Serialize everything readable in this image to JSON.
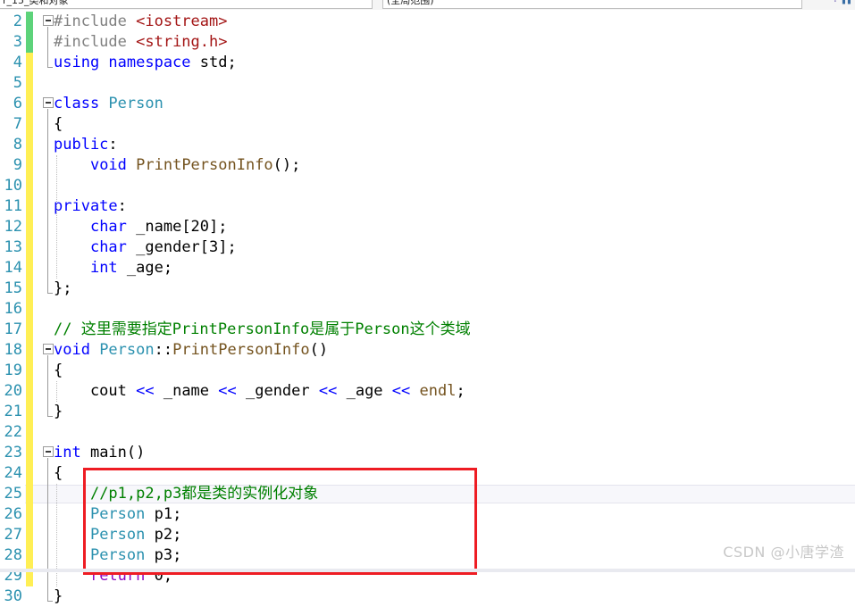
{
  "window": {
    "scope_left_label": "r_15_类和对象",
    "scope_right_label": "(全局范围)",
    "nav_back_icon": "navigate-back-icon",
    "nav_split_icon": "split-view-icon"
  },
  "editor": {
    "first_line_number": 2,
    "line_height_px": 23,
    "gutter": {
      "line_numbers": [
        2,
        3,
        4,
        5,
        6,
        7,
        8,
        9,
        10,
        11,
        12,
        13,
        14,
        15,
        16,
        17,
        18,
        19,
        20,
        21,
        22,
        23,
        24,
        25,
        26,
        27,
        28,
        29,
        30
      ],
      "change_bar": [
        {
          "status": "saved",
          "color": "#5dd37a",
          "from_line": 2,
          "to_line": 3
        },
        {
          "status": "unsaved",
          "color": "#ffef55",
          "from_line": 4,
          "to_line": 29
        }
      ]
    },
    "lines": [
      {
        "n": 2,
        "indent": 0,
        "fold": "open",
        "tokens": [
          {
            "t": "#include ",
            "c": "pre"
          },
          {
            "t": "<iostream>",
            "c": "str"
          }
        ]
      },
      {
        "n": 3,
        "indent": 0,
        "fold": "mid",
        "tokens": [
          {
            "t": "#include ",
            "c": "pre"
          },
          {
            "t": "<string.h>",
            "c": "str"
          }
        ]
      },
      {
        "n": 4,
        "indent": 0,
        "fold": "end",
        "tokens": [
          {
            "t": "using namespace ",
            "c": "kw"
          },
          {
            "t": "std;",
            "c": "plain"
          }
        ]
      },
      {
        "n": 5,
        "indent": 0,
        "fold": "none",
        "tokens": []
      },
      {
        "n": 6,
        "indent": 0,
        "fold": "open",
        "tokens": [
          {
            "t": "class ",
            "c": "kw"
          },
          {
            "t": "Person",
            "c": "type"
          }
        ]
      },
      {
        "n": 7,
        "indent": 0,
        "fold": "mid",
        "tokens": [
          {
            "t": "{",
            "c": "plain"
          }
        ]
      },
      {
        "n": 8,
        "indent": 0,
        "fold": "mid",
        "tokens": [
          {
            "t": "public",
            "c": "kw"
          },
          {
            "t": ":",
            "c": "plain"
          }
        ]
      },
      {
        "n": 9,
        "indent": 1,
        "fold": "mid",
        "tokens": [
          {
            "t": "    ",
            "c": "plain"
          },
          {
            "t": "void ",
            "c": "kw"
          },
          {
            "t": "PrintPersonInfo",
            "c": "fn"
          },
          {
            "t": "();",
            "c": "plain"
          }
        ]
      },
      {
        "n": 10,
        "indent": 1,
        "fold": "mid",
        "tokens": []
      },
      {
        "n": 11,
        "indent": 0,
        "fold": "mid",
        "tokens": [
          {
            "t": "private",
            "c": "kw"
          },
          {
            "t": ":",
            "c": "plain"
          }
        ]
      },
      {
        "n": 12,
        "indent": 1,
        "fold": "mid",
        "tokens": [
          {
            "t": "    ",
            "c": "plain"
          },
          {
            "t": "char ",
            "c": "kw"
          },
          {
            "t": "_name[20];",
            "c": "plain"
          }
        ]
      },
      {
        "n": 13,
        "indent": 1,
        "fold": "mid",
        "tokens": [
          {
            "t": "    ",
            "c": "plain"
          },
          {
            "t": "char ",
            "c": "kw"
          },
          {
            "t": "_gender[3];",
            "c": "plain"
          }
        ]
      },
      {
        "n": 14,
        "indent": 1,
        "fold": "mid",
        "tokens": [
          {
            "t": "    ",
            "c": "plain"
          },
          {
            "t": "int ",
            "c": "kw"
          },
          {
            "t": "_age;",
            "c": "plain"
          }
        ]
      },
      {
        "n": 15,
        "indent": 0,
        "fold": "end",
        "tokens": [
          {
            "t": "};",
            "c": "plain"
          }
        ]
      },
      {
        "n": 16,
        "indent": 0,
        "fold": "none",
        "tokens": []
      },
      {
        "n": 17,
        "indent": 0,
        "fold": "none",
        "tokens": [
          {
            "t": "// 这里需要指定PrintPersonInfo是属于Person这个类域",
            "c": "cmt"
          }
        ]
      },
      {
        "n": 18,
        "indent": 0,
        "fold": "open",
        "tokens": [
          {
            "t": "void ",
            "c": "kw"
          },
          {
            "t": "Person",
            "c": "type"
          },
          {
            "t": "::",
            "c": "plain"
          },
          {
            "t": "PrintPersonInfo",
            "c": "fn"
          },
          {
            "t": "()",
            "c": "plain"
          }
        ]
      },
      {
        "n": 19,
        "indent": 0,
        "fold": "mid",
        "tokens": [
          {
            "t": "{",
            "c": "plain"
          }
        ]
      },
      {
        "n": 20,
        "indent": 1,
        "fold": "mid",
        "tokens": [
          {
            "t": "    cout ",
            "c": "plain"
          },
          {
            "t": "<< ",
            "c": "op"
          },
          {
            "t": "_name ",
            "c": "plain"
          },
          {
            "t": "<< ",
            "c": "op"
          },
          {
            "t": "_gender ",
            "c": "plain"
          },
          {
            "t": "<< ",
            "c": "op"
          },
          {
            "t": "_age ",
            "c": "plain"
          },
          {
            "t": "<< ",
            "c": "op"
          },
          {
            "t": "endl",
            "c": "fn"
          },
          {
            "t": ";",
            "c": "plain"
          }
        ]
      },
      {
        "n": 21,
        "indent": 0,
        "fold": "end",
        "tokens": [
          {
            "t": "}",
            "c": "plain"
          }
        ]
      },
      {
        "n": 22,
        "indent": 0,
        "fold": "none",
        "tokens": []
      },
      {
        "n": 23,
        "indent": 0,
        "fold": "open",
        "tokens": [
          {
            "t": "int ",
            "c": "kw"
          },
          {
            "t": "main",
            "c": "plain"
          },
          {
            "t": "()",
            "c": "plain"
          }
        ]
      },
      {
        "n": 24,
        "indent": 0,
        "fold": "mid",
        "tokens": [
          {
            "t": "{",
            "c": "plain"
          }
        ]
      },
      {
        "n": 25,
        "indent": 1,
        "fold": "mid",
        "tokens": [
          {
            "t": "    ",
            "c": "plain"
          },
          {
            "t": "//p1,p2,p3都是类的实例化对象",
            "c": "cmt"
          }
        ]
      },
      {
        "n": 26,
        "indent": 1,
        "fold": "mid",
        "tokens": [
          {
            "t": "    ",
            "c": "plain"
          },
          {
            "t": "Person",
            "c": "type"
          },
          {
            "t": " p1;",
            "c": "plain"
          }
        ]
      },
      {
        "n": 27,
        "indent": 1,
        "fold": "mid",
        "tokens": [
          {
            "t": "    ",
            "c": "plain"
          },
          {
            "t": "Person",
            "c": "type"
          },
          {
            "t": " p2;",
            "c": "plain"
          }
        ]
      },
      {
        "n": 28,
        "indent": 1,
        "fold": "mid",
        "tokens": [
          {
            "t": "    ",
            "c": "plain"
          },
          {
            "t": "Person",
            "c": "type"
          },
          {
            "t": " p3;",
            "c": "plain"
          }
        ]
      },
      {
        "n": 29,
        "indent": 1,
        "fold": "mid",
        "tokens": [
          {
            "t": "    ",
            "c": "plain"
          },
          {
            "t": "return ",
            "c": "ctrl"
          },
          {
            "t": "0;",
            "c": "plain"
          }
        ]
      },
      {
        "n": 30,
        "indent": 0,
        "fold": "end",
        "tokens": [
          {
            "t": "}",
            "c": "plain"
          }
        ]
      }
    ],
    "current_line": 25,
    "annotation": {
      "shape": "rectangle",
      "color": "#ee1c23",
      "covers_lines": [
        25,
        26,
        27,
        28
      ]
    }
  },
  "watermark": {
    "text": "CSDN @小唐学渣"
  }
}
